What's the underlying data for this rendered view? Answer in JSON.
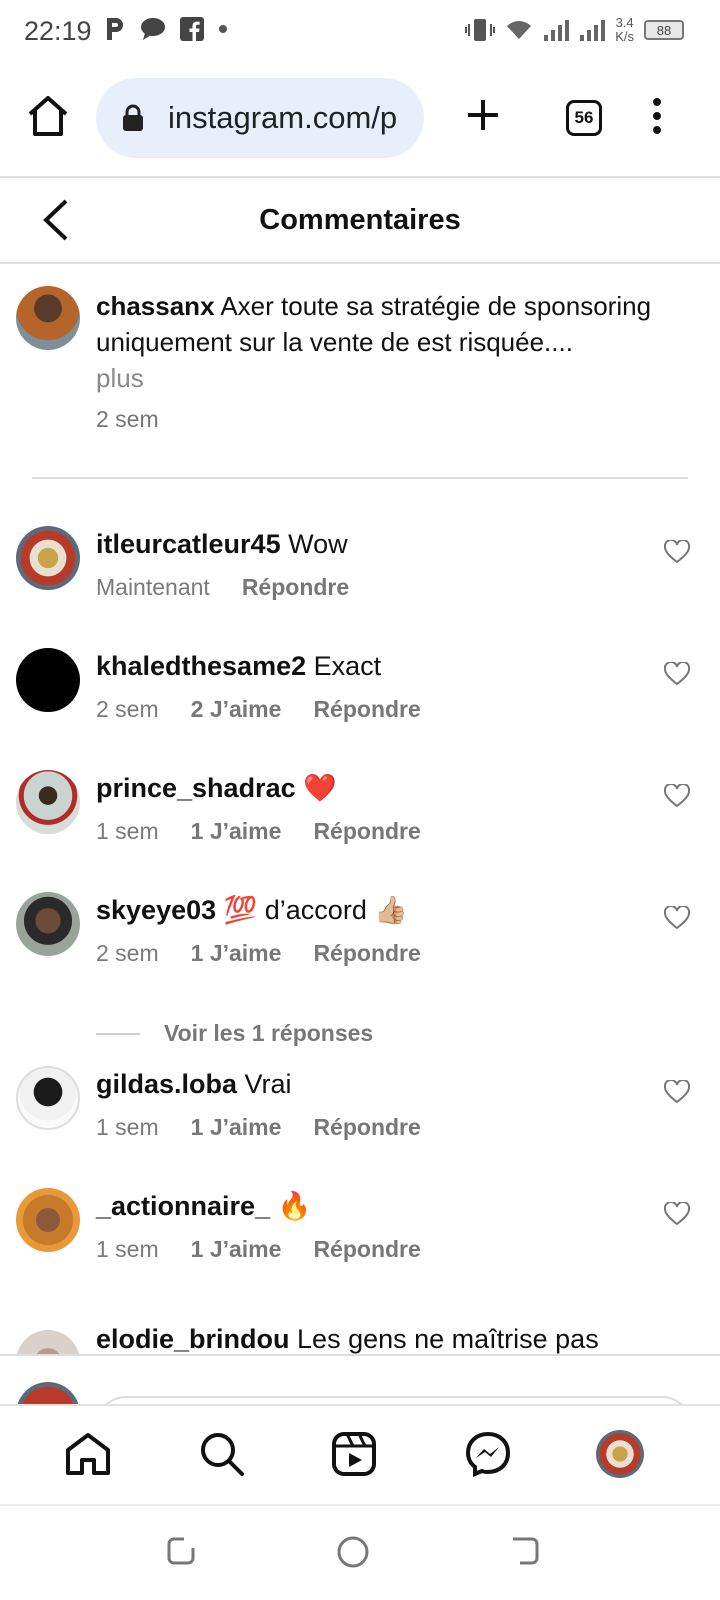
{
  "status_bar": {
    "time": "22:19",
    "net_speed_value": "3.4",
    "net_speed_unit": "K/s",
    "battery": "88"
  },
  "browser": {
    "url": "instagram.com/p",
    "tab_count": "56"
  },
  "header": {
    "title": "Commentaires"
  },
  "caption": {
    "user": "chassanx",
    "text": "Axer toute sa stratégie de sponsoring uniquement sur la vente de est risquée....",
    "more": "plus",
    "time": "2 sem"
  },
  "comments": [
    {
      "user": "itleurcatleur45",
      "text": "Wow",
      "time": "Maintenant",
      "likes": "",
      "reply": "Répondre"
    },
    {
      "user": "khaledthesame2",
      "text": "Exact",
      "time": "2 sem",
      "likes": "2 J’aime",
      "reply": "Répondre"
    },
    {
      "user": "prince_shadrac",
      "text": "❤️",
      "time": "1 sem",
      "likes": "1 J’aime",
      "reply": "Répondre"
    },
    {
      "user": "skyeye03",
      "text": "💯 d’accord 👍🏼",
      "time": "2 sem",
      "likes": "1 J’aime",
      "reply": "Répondre"
    },
    {
      "user": "gildas.loba",
      "text": "Vrai",
      "time": "1 sem",
      "likes": "1 J’aime",
      "reply": "Répondre"
    },
    {
      "user": "_actionnaire_",
      "text": "🔥",
      "time": "1 sem",
      "likes": "1 J’aime",
      "reply": "Répondre"
    }
  ],
  "view_replies": "Voir les 1 réponses",
  "partial_comment": {
    "user": "elodie_brindou",
    "text": "Les gens ne maîtrise pas"
  },
  "colors": {
    "accent_url_bg": "#e8eefa",
    "muted_text": "#7a7a7a",
    "divider": "#dddddd"
  }
}
